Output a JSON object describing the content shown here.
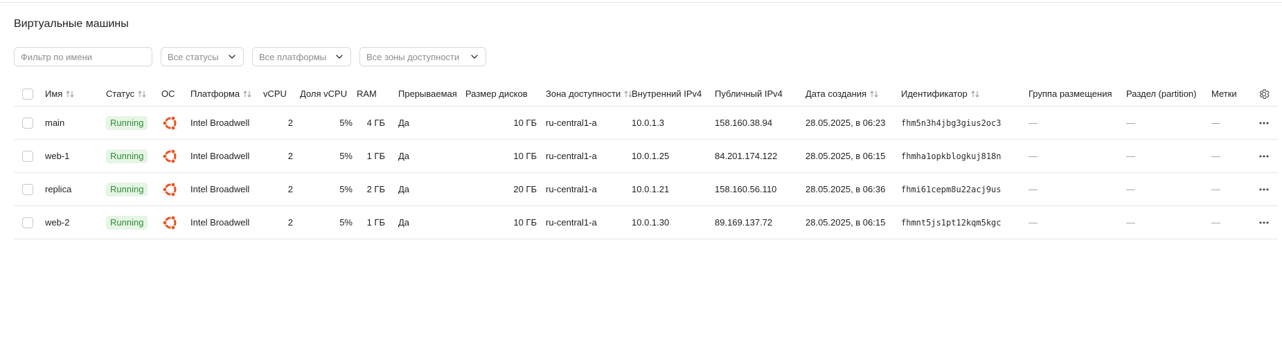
{
  "page": {
    "title": "Виртуальные машины"
  },
  "filters": {
    "name_placeholder": "Фильтр по имени",
    "status": "Все статусы",
    "platform": "Все платформы",
    "zone": "Все зоны доступности"
  },
  "table": {
    "headers": {
      "name": "Имя",
      "status": "Статус",
      "os": "ОС",
      "platform": "Платформа",
      "vcpu": "vCPU",
      "vcpu_share": "Доля vCPU",
      "ram": "RAM",
      "preemptible": "Прерываемая",
      "disk_size": "Размер дисков",
      "zone": "Зона доступности",
      "internal_ip": "Внутренний IPv4",
      "public_ip": "Публичный IPv4",
      "created": "Дата создания",
      "id": "Идентификатор",
      "placement_group": "Группа размещения",
      "partition": "Раздел (partition)",
      "labels": "Метки"
    },
    "rows": [
      {
        "name": "main",
        "status": "Running",
        "os_icon": "ubuntu-icon",
        "platform": "Intel Broadwell",
        "vcpu": "2",
        "vcpu_share": "5%",
        "ram": "4 ГБ",
        "preemptible": "Да",
        "disk_size": "10 ГБ",
        "zone": "ru-central1-a",
        "internal_ip": "10.0.1.3",
        "public_ip": "158.160.38.94",
        "created": "28.05.2025, в 06:23",
        "id": "fhm5n3h4jbg3gius2oc3",
        "placement_group": "—",
        "partition": "—",
        "labels": "—"
      },
      {
        "name": "web-1",
        "status": "Running",
        "os_icon": "ubuntu-icon",
        "platform": "Intel Broadwell",
        "vcpu": "2",
        "vcpu_share": "5%",
        "ram": "1 ГБ",
        "preemptible": "Да",
        "disk_size": "10 ГБ",
        "zone": "ru-central1-a",
        "internal_ip": "10.0.1.25",
        "public_ip": "84.201.174.122",
        "created": "28.05.2025, в 06:15",
        "id": "fhmha1opkblogkuj818n",
        "placement_group": "—",
        "partition": "—",
        "labels": "—"
      },
      {
        "name": "replica",
        "status": "Running",
        "os_icon": "ubuntu-icon",
        "platform": "Intel Broadwell",
        "vcpu": "2",
        "vcpu_share": "5%",
        "ram": "2 ГБ",
        "preemptible": "Да",
        "disk_size": "20 ГБ",
        "zone": "ru-central1-a",
        "internal_ip": "10.0.1.21",
        "public_ip": "158.160.56.110",
        "created": "28.05.2025, в 06:36",
        "id": "fhmi61cepm8u22acj9us",
        "placement_group": "—",
        "partition": "—",
        "labels": "—"
      },
      {
        "name": "web-2",
        "status": "Running",
        "os_icon": "ubuntu-icon",
        "platform": "Intel Broadwell",
        "vcpu": "2",
        "vcpu_share": "5%",
        "ram": "1 ГБ",
        "preemptible": "Да",
        "disk_size": "10 ГБ",
        "zone": "ru-central1-a",
        "internal_ip": "10.0.1.30",
        "public_ip": "89.169.137.72",
        "created": "28.05.2025, в 06:15",
        "id": "fhmnt5js1pt12kqm5kgc",
        "placement_group": "—",
        "partition": "—",
        "labels": "—"
      }
    ]
  },
  "colors": {
    "status_running_bg": "#e6f5e6",
    "status_running_text": "#2f8d34",
    "ubuntu_orange": "#e95420"
  }
}
